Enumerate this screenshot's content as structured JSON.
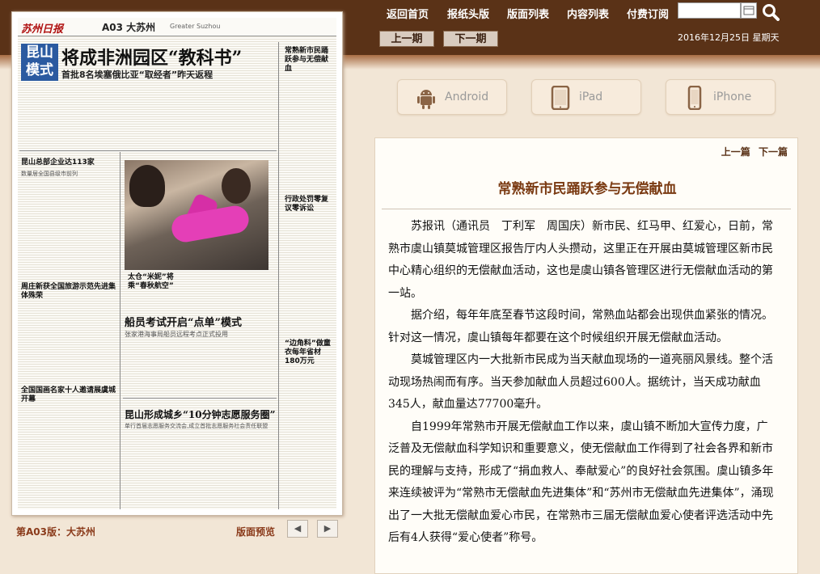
{
  "nav": {
    "items": [
      "返回首页",
      "报纸头版",
      "版面列表",
      "内容列表",
      "付费订阅"
    ],
    "search_placeholder": ""
  },
  "issue": {
    "prev_label": "上一期",
    "next_label": "下一期",
    "date": "2016年12月25日 星期天"
  },
  "apps": [
    {
      "label": "Android",
      "icon": "android-icon"
    },
    {
      "label": "iPad",
      "icon": "ipad-icon"
    },
    {
      "label": "iPhone",
      "icon": "iphone-icon"
    }
  ],
  "paper": {
    "logo": "苏州日报",
    "page_name": "A03 大苏州",
    "page_name_en": "Greater Suzhou",
    "lead_box": "昆山模式",
    "lead_title": "将成非洲园区“教科书”",
    "lead_sub": "首批8名埃塞俄比亚“取经者”昨天返程",
    "right_head": "常熟新市民踊跃参与无偿献血",
    "left_head1": "昆山总部企业达113家",
    "left_sub1": "数量居全国县级市前列",
    "left_head2": "周庄新获全国旅游示范先进集体殊荣",
    "left_head3": "全国国画名家十人邀请展虞城开幕",
    "photo_caption": "太仓“米妮”将乘“春秋航空”",
    "right_head2": "行政处罚零复议零诉讼",
    "right_head3": "“边角料”做童衣每年省材180万元",
    "mid_head1": "船员考试开启“点单”模式",
    "mid_sub1": "张家港海事局船员远程考点正式投用",
    "mid_head2": "昆山形成城乡“10分钟志愿服务圈”",
    "mid_sub2": "单行首届志愿服务交流会,成立首批志愿服务社会责任联盟"
  },
  "footer": {
    "page_label": "第A03版：大苏州",
    "preview_label": "版面预览",
    "prev_arrow": "◀",
    "next_arrow": "▶"
  },
  "article": {
    "prev_label": "上一篇",
    "next_label": "下一篇",
    "title": "常熟新市民踊跃参与无偿献血",
    "paragraphs": [
      "苏报讯（通讯员　丁利军　周国庆）新市民、红马甲、红爱心，日前，常熟市虞山镇莫城管理区报告厅内人头攒动，这里正在开展由莫城管理区新市民中心精心组织的无偿献血活动，这也是虞山镇各管理区进行无偿献血活动的第一站。",
      "据介绍，每年年底至春节这段时间，常熟血站都会出现供血紧张的情况。针对这一情况，虞山镇每年都要在这个时候组织开展无偿献血活动。",
      "莫城管理区内一大批新市民成为当天献血现场的一道亮丽风景线。整个活动现场热闹而有序。当天参加献血人员超过600人。据统计，当天成功献血345人，献血量达77700毫升。",
      "自1999年常熟市开展无偿献血工作以来，虞山镇不断加大宣传力度，广泛普及无偿献血科学知识和重要意义，使无偿献血工作得到了社会各界和新市民的理解与支持，形成了“捐血救人、奉献爱心”的良好社会氛围。虞山镇多年来连续被评为“常熟市无偿献血先进集体”和“苏州市无偿献血先进集体”，涌现出了一大批无偿献血爱心市民，在常熟市三届无偿献血爱心使者评选活动中先后有4人获得“爱心使者”称号。"
    ]
  }
}
